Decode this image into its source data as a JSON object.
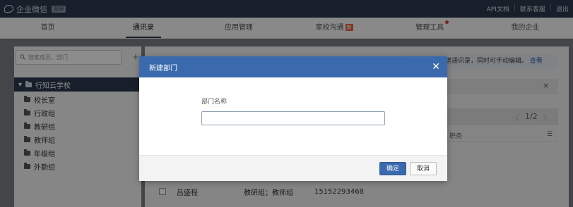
{
  "app": {
    "title": "企业微信",
    "badge": "管理"
  },
  "top_links": [
    "API文档",
    "联系客服",
    "退出"
  ],
  "nav": {
    "tabs": [
      {
        "label": "首页"
      },
      {
        "label": "通讯录"
      },
      {
        "label": "应用管理"
      },
      {
        "label": "家校沟通",
        "badge": "新"
      },
      {
        "label": "管理工具"
      },
      {
        "label": "我的企业"
      }
    ]
  },
  "sidebar": {
    "search_placeholder": "搜索成员、部门",
    "add_symbol": "+",
    "root": "行知云学校",
    "items": [
      "校长室",
      "行政组",
      "教研组",
      "教师组",
      "年级组",
      "外勤组"
    ]
  },
  "main": {
    "info_text": "建通讯录，同时可手动编辑。",
    "info_link": "查看",
    "notice_close": "×",
    "pager": {
      "prev": "〈",
      "current": "1/2",
      "next": "〉"
    },
    "col_position": "职务",
    "col_menu": "☰",
    "row": {
      "name": "吕盛程",
      "dept": "教研组；教师组",
      "phone": "15152293468"
    }
  },
  "dialog": {
    "title": "新建部门",
    "close": "✕",
    "field_label": "部门名称",
    "field_value": "",
    "confirm": "确定",
    "cancel": "取消"
  },
  "colors": {
    "topbar": "#2b3a4d",
    "dialog_header": "#3a6aad",
    "overlay": "rgba(0,0,0,0.45)"
  }
}
